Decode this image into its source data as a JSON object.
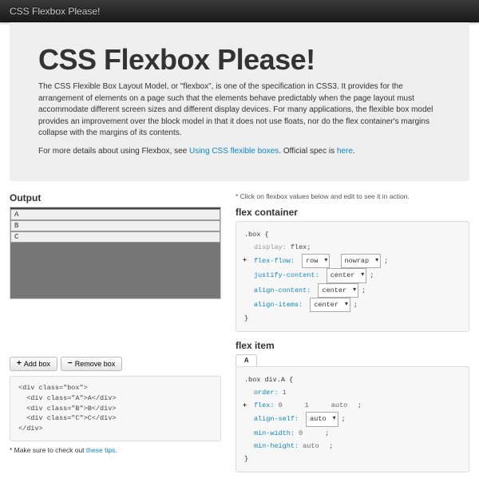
{
  "topbar": {
    "brand": "CSS Flexbox Please!"
  },
  "hero": {
    "title": "CSS Flexbox Please!",
    "body": "The CSS Flexible Box Layout Model, or \"flexbox\", is one of the specification in CSS3. It provides for the arrangement of elements on a page such that the elements behave predictably when the page layout must accommodate different screen sizes and different display devices. For many applications, the flexible box model provides an improvement over the block model in that it does not use floats, nor do the flex container's margins collapse with the margins of its contents.",
    "more_prefix": "For more details about using Flexbox, see ",
    "more_link1": "Using CSS flexible boxes",
    "more_mid": ". Official spec is ",
    "more_link2": "here",
    "more_suffix": "."
  },
  "left": {
    "output_heading": "Output",
    "boxes": {
      "a": "A",
      "b": "B",
      "c": "C"
    },
    "add_btn": "Add box",
    "remove_btn": "Remove box",
    "markup": "<div class=\"box\">\n  <div class=\"A\">A</div>\n  <div class=\"B\">B</div>\n  <div class=\"C\">C</div>\n</div>",
    "tips_prefix": "* Make sure to check out ",
    "tips_link": "these tips",
    "tips_suffix": "."
  },
  "right": {
    "hint": "* Click on flexbox values below and edit to see it in action.",
    "container": {
      "heading": "flex container",
      "selector": ".box {",
      "display_label": "display:",
      "display_value": "flex;",
      "flexflow_label": "flex-flow:",
      "flexflow_dir": "row",
      "flexflow_wrap": "nowrap",
      "justify_label": "justify-content:",
      "justify_value": "center",
      "aligncontent_label": "align-content:",
      "aligncontent_value": "center",
      "alignitems_label": "align-items:",
      "alignitems_value": "center",
      "close": "}"
    },
    "item": {
      "heading": "flex item",
      "tab": "A",
      "selector": ".box div.A {",
      "order_label": "order:",
      "order_value": "1",
      "flex_label": "flex:",
      "flex_grow": "0",
      "flex_shrink": "1",
      "flex_basis": "auto",
      "alignself_label": "align-self:",
      "alignself_value": "auto",
      "minw_label": "min-width:",
      "minw_value": "0",
      "minh_label": "min-height:",
      "minh_value": "auto",
      "close": "}"
    }
  }
}
